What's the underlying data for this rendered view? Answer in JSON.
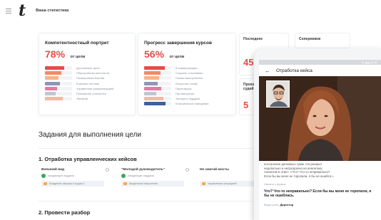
{
  "header": {
    "logo_text": "t",
    "nav_title": "Ваша статистика"
  },
  "competence": {
    "title": "Компетентностный портрет",
    "percent": "78%",
    "percent_suffix": "от цели",
    "percent_value": 78,
    "items": [
      {
        "label": "Достижение цели",
        "color": "#e84b4b",
        "value": 0.7
      },
      {
        "label": "Обустройство местности",
        "color": "#f08a6a",
        "value": 0.6
      },
      {
        "label": "Позиционная борьба",
        "color": "#f4b48c",
        "value": 0.5
      },
      {
        "label": "Ближняя техника",
        "color": "#8b97b5",
        "value": 0.55
      },
      {
        "label": "Управление коммуникацией",
        "color": "#e57aa0",
        "value": 0.45
      },
      {
        "label": "Понимание оппонента",
        "color": "#c0c6d2",
        "value": 0.4
      },
      {
        "label": "Эмпатия",
        "color": "#f5b8a6",
        "value": 0.65
      }
    ]
  },
  "progress": {
    "title": "Прогресс завершения курсов",
    "percent": "56%",
    "percent_suffix": "от цели",
    "percent_value": 56,
    "items": [
      {
        "label": "В коммуникации",
        "color": "#e84b4b",
        "value": 0.75
      },
      {
        "label": "Слушать и понимать",
        "color": "#f08a6a",
        "value": 0.6
      },
      {
        "label": "Логика выступления",
        "color": "#f4b48c",
        "value": 0.55
      },
      {
        "label": "Искусство слова",
        "color": "#8b97b5",
        "value": 0.5
      },
      {
        "label": "Переговоры",
        "color": "#e57aa0",
        "value": 0.62
      },
      {
        "label": "Противоречия",
        "color": "#c0c6d2",
        "value": 0.45
      },
      {
        "label": "Экспресс-поддача",
        "color": "#f5b8a6",
        "value": 0.7
      },
      {
        "label": "Классическое поведение",
        "color": "#3f5f9e",
        "value": 0.8
      }
    ]
  },
  "recent": {
    "title": "Последнее",
    "value": "45"
  },
  "rivals": {
    "title": "Соперников"
  },
  "judges": {
    "title_line1": "Прохо",
    "title_line2": "судей",
    "value": "5"
  },
  "tasks_section": {
    "title": "Задания для выполнения цели"
  },
  "task_group_1": {
    "title": "1. Отработка управленческих кейсов",
    "tasks": [
      {
        "name": "Внешний вид",
        "status": "ожидающих поддачи",
        "tag": "Владение языком и кодом 2"
      },
      {
        "name": "\"Молодой руководитель\"",
        "status": "ожидающих поддачи",
        "tag": "Модельное мышление"
      },
      {
        "name": "Не сжигай мосты",
        "status": "",
        "tag": "Управление ситуацией"
      }
    ]
  },
  "task_group_2": {
    "title": "2. Провести разбор"
  },
  "phone": {
    "status_text": "▼ ◢ ▬ 11:15",
    "back_glyph": "←",
    "title": "Отработка кейса",
    "description_lines": [
      "ностроение денежных сумм. Он раскрыт",
      "недовольно и непрозрачно на аналитику.",
      "Аналитик в ответ: «Что? Что-то неправильно?",
      "Если бы вы меня не торопили, я бы не ошибся.»"
    ],
    "phrase_label": "Начало с фразы",
    "quote": "Что? Что-то неправильно? Если бы вы меня не торопили, я бы не ошиблась.",
    "role_label": "Ваша роль:",
    "role_value": "Директор"
  }
}
